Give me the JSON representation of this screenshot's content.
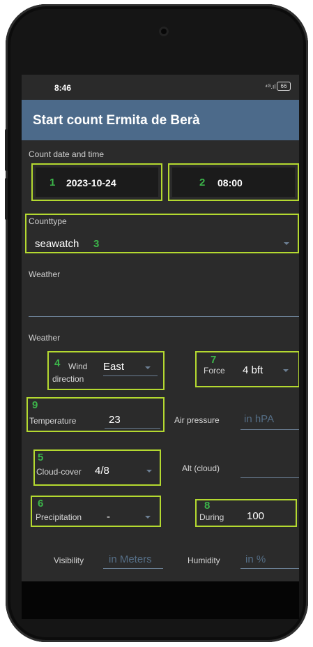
{
  "status": {
    "time": "8:46",
    "signal": "⁴ᴳ.ıl",
    "battery": "66"
  },
  "app": {
    "title": "Start count Ermita de Berà"
  },
  "count_datetime": {
    "label": "Count date and time",
    "date": "2023-10-24",
    "time": "08:00",
    "date_marker": "1",
    "time_marker": "2"
  },
  "counttype": {
    "label": "Counttype",
    "value": "seawatch",
    "marker": "3"
  },
  "weather_notes": {
    "label": "Weather"
  },
  "weather": {
    "label": "Weather",
    "wind_direction": {
      "label_line1": "Wind",
      "label_line2": "direction",
      "value": "East",
      "marker": "4"
    },
    "force": {
      "label": "Force",
      "value": "4 bft",
      "marker": "7"
    },
    "temperature": {
      "label": "Temperature",
      "value": "23",
      "marker": "9"
    },
    "air_pressure": {
      "label": "Air pressure",
      "placeholder": "in hPA"
    },
    "cloud_cover": {
      "label": "Cloud-cover",
      "value": "4/8",
      "marker": "5"
    },
    "alt_cloud": {
      "label": "Alt (cloud)"
    },
    "precipitation": {
      "label": "Precipitation",
      "value": "-",
      "marker": "6"
    },
    "during": {
      "label": "During",
      "value": "100",
      "marker": "8"
    },
    "visibility": {
      "label": "Visibility",
      "placeholder": "in Meters"
    },
    "humidity": {
      "label": "Humidity",
      "placeholder": "in %"
    }
  },
  "colors": {
    "appbar": "#4c6a8a",
    "highlight": "#b4d930",
    "marker": "#3cb54a",
    "background": "#2b2b2b"
  }
}
